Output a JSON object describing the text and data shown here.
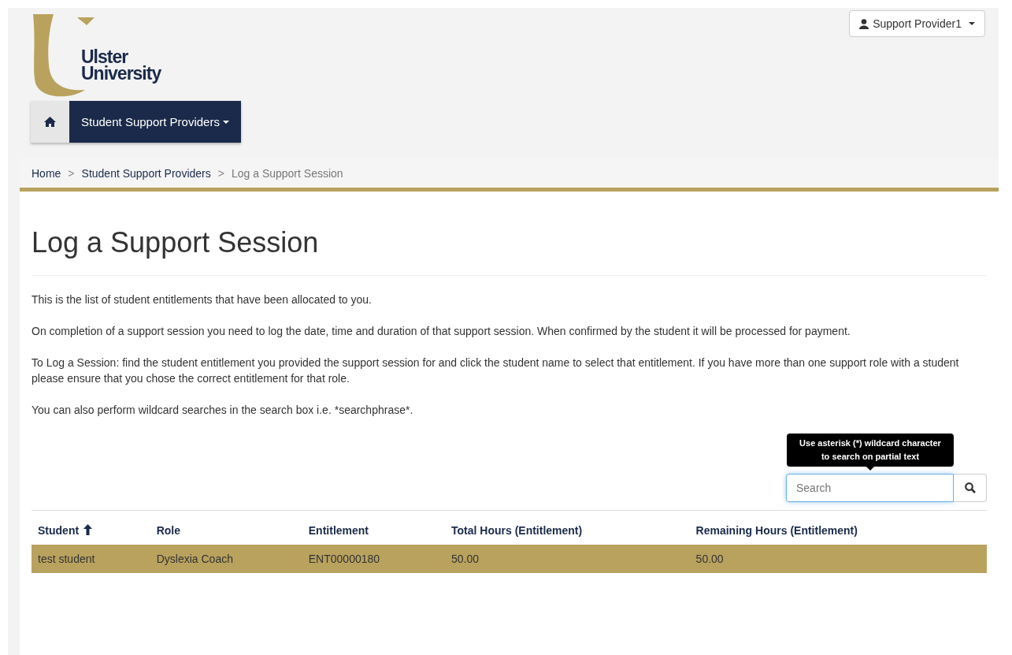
{
  "logo": {
    "line1": "Ulster",
    "line2": "University"
  },
  "user_menu": {
    "label": "Support Provider1"
  },
  "nav": {
    "items": [
      {
        "label": "Student Support Providers",
        "selected": true
      }
    ]
  },
  "breadcrumb_separator": ">",
  "breadcrumb": [
    {
      "label": "Home",
      "current": false
    },
    {
      "label": "Student Support Providers",
      "current": false
    },
    {
      "label": "Log a Support Session",
      "current": true
    }
  ],
  "page_title": "Log a Support Session",
  "paragraphs": [
    "This is the list of student entitlements that have been allocated to you.",
    "On completion of a support session you need to log the date, time and duration of that support session.  When confirmed by the student it will be processed for payment.",
    "To Log a Session: find the student entitlement you provided the support session for and click the student name to select that entitlement.  If you have more than one support role with a student please ensure that you chose the correct entitlement for that role.",
    "You can also perform wildcard searches in the search box i.e. *searchphrase*."
  ],
  "search": {
    "placeholder": "Search",
    "tooltip": "Use asterisk (*) wildcard character to search on partial text"
  },
  "table": {
    "columns": [
      {
        "label": "Student",
        "sorted": true
      },
      {
        "label": "Role",
        "sorted": false
      },
      {
        "label": "Entitlement",
        "sorted": false
      },
      {
        "label": "Total Hours (Entitlement)",
        "sorted": false
      },
      {
        "label": "Remaining Hours (Entitlement)",
        "sorted": false
      }
    ],
    "rows": [
      {
        "cells": [
          "test student",
          "Dyslexia Coach",
          "ENT00000180",
          "50.00",
          "50.00"
        ],
        "selected": true
      }
    ]
  }
}
